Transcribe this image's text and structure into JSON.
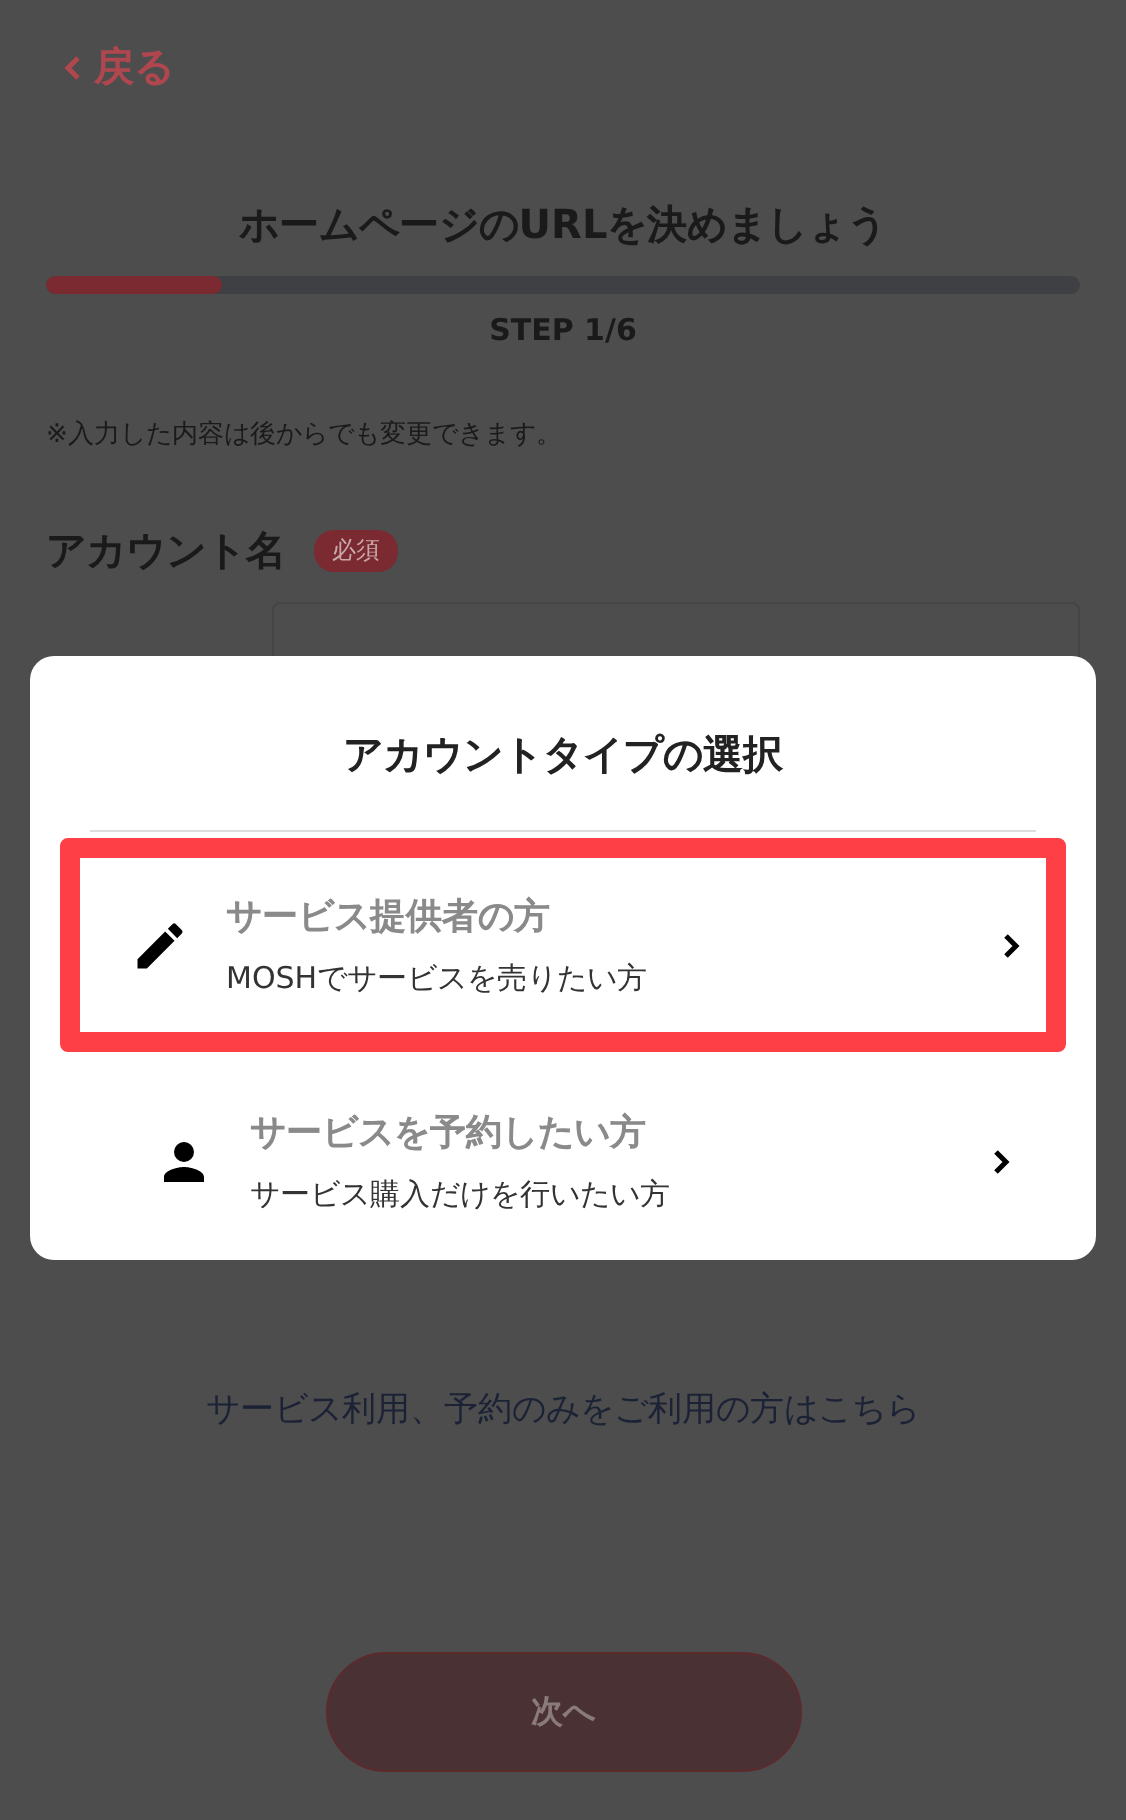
{
  "back": {
    "label": "戻る"
  },
  "title": "ホームページのURLを決めましょう",
  "progress": {
    "level": 0.17,
    "step": "STEP 1/6"
  },
  "note": "※入力した内容は後からでも変更できます。",
  "account_name": {
    "label": "アカウント名",
    "badge": "必須"
  },
  "link": "サービス利用、予約のみをご利用の方はこちら",
  "next_button": {
    "label": "次へ",
    "disabled": true
  },
  "dialog": {
    "title": "アカウントタイプの選択",
    "options": [
      {
        "kind": "pencil",
        "title": "サービス提供者の方",
        "subtitle": "MOSHでサービスを売りたい方",
        "selected": true
      },
      {
        "kind": "person",
        "title": "サービスを予約したい方",
        "subtitle": "サービス購入だけを行いたい方",
        "selected": false
      }
    ]
  }
}
